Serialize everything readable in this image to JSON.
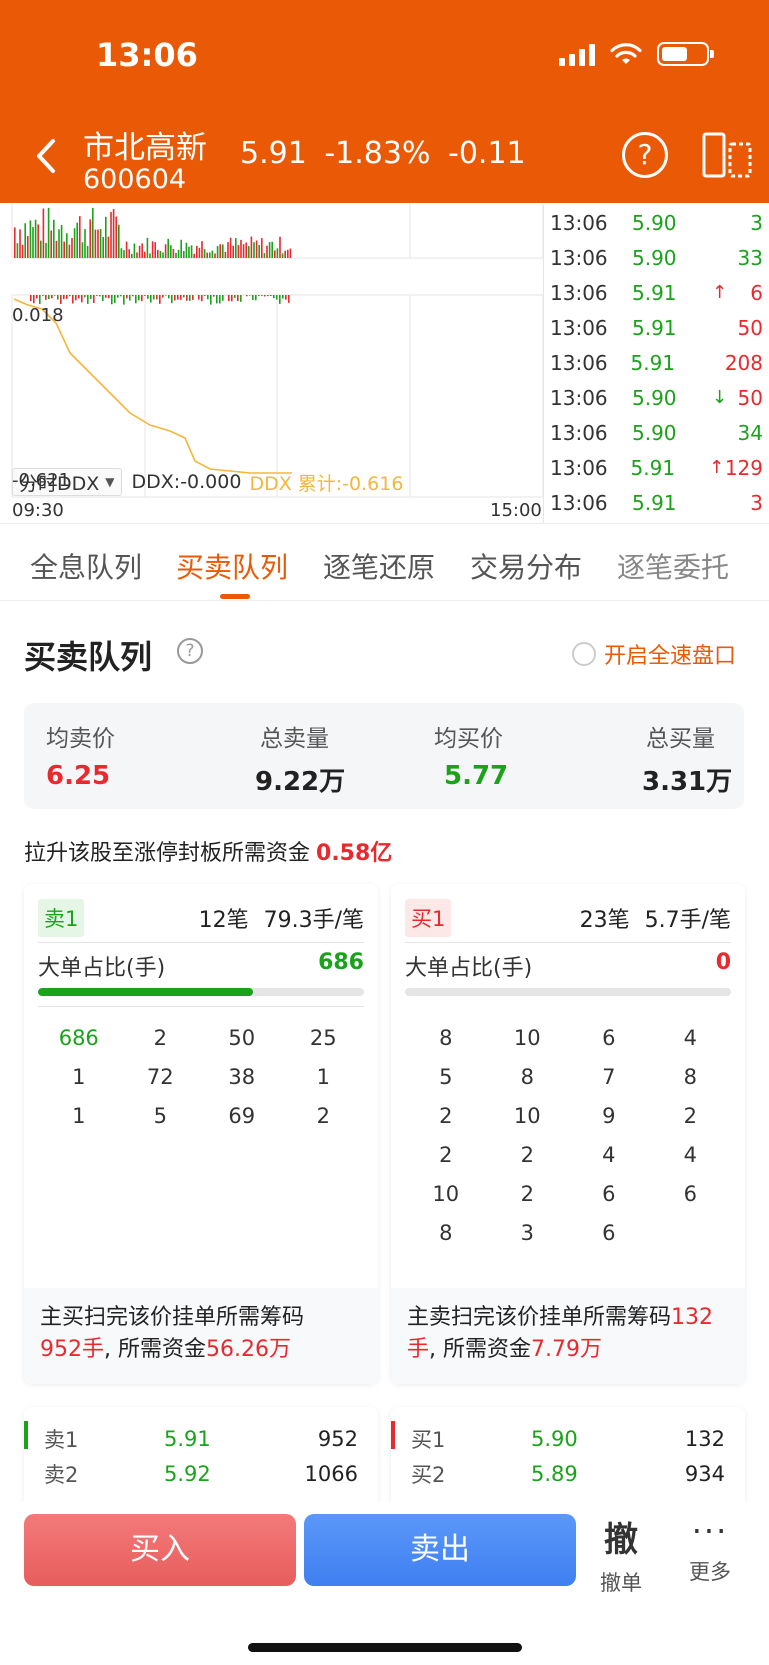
{
  "status_bar": {
    "time": "13:06"
  },
  "header": {
    "stock_name": "市北高新",
    "stock_code": "600604",
    "quote": "5.91  -1.83%  -0.11",
    "help_icon": "?"
  },
  "chart": {
    "ddx_selector": "分时DDX",
    "ddx_value": "DDX:-0.000",
    "ddx_total": "DDX 累计:-0.616",
    "y_top": "0.018",
    "y_bottom": "-0.621",
    "x_start": "09:30",
    "x_end": "15:00",
    "line_color": "#f5b63c"
  },
  "ticks": [
    {
      "time": "13:06",
      "price": "5.90",
      "arrow": "",
      "vol": "3",
      "vol_color": "green"
    },
    {
      "time": "13:06",
      "price": "5.90",
      "arrow": "",
      "vol": "33",
      "vol_color": "green"
    },
    {
      "time": "13:06",
      "price": "5.91",
      "arrow": "↑",
      "vol": "6",
      "vol_color": "red"
    },
    {
      "time": "13:06",
      "price": "5.91",
      "arrow": "",
      "vol": "50",
      "vol_color": "red"
    },
    {
      "time": "13:06",
      "price": "5.91",
      "arrow": "",
      "vol": "208",
      "vol_color": "red"
    },
    {
      "time": "13:06",
      "price": "5.90",
      "arrow": "↓",
      "vol": "50",
      "vol_color": "red"
    },
    {
      "time": "13:06",
      "price": "5.90",
      "arrow": "",
      "vol": "34",
      "vol_color": "green"
    },
    {
      "time": "13:06",
      "price": "5.91",
      "arrow": "↑",
      "vol": "129",
      "vol_color": "red"
    },
    {
      "time": "13:06",
      "price": "5.91",
      "arrow": "",
      "vol": "3",
      "vol_color": "red"
    }
  ],
  "tabs": [
    "全息队列",
    "买卖队列",
    "逐笔还原",
    "交易分布",
    "逐笔委托"
  ],
  "active_tab": "买卖队列",
  "section": {
    "title": "买卖队列",
    "help": "?",
    "fast_toggle": "开启全速盘口"
  },
  "summary": {
    "avg_sell_label": "均卖价",
    "avg_sell": "6.25",
    "total_sell_label": "总卖量",
    "total_sell": "9.22万",
    "avg_buy_label": "均买价",
    "avg_buy": "5.77",
    "total_buy_label": "总买量",
    "total_buy": "3.31万"
  },
  "raise": {
    "label": "拉升该股至涨停封板所需资金",
    "value": "0.58亿"
  },
  "sell_queue": {
    "badge": "卖1",
    "meta": "12笔  79.3手/笔",
    "big_label": "大单占比(手)",
    "big_value": "686",
    "big_ratio": 0.66,
    "rows": [
      [
        "686",
        "2",
        "50",
        "25"
      ],
      [
        "1",
        "72",
        "38",
        "1"
      ],
      [
        "1",
        "5",
        "69",
        "2"
      ]
    ],
    "foot_a": "主买扫完该价挂单所需筹码",
    "foot_b": "952手",
    "foot_c": ", 所需资金",
    "foot_d": "56.26万"
  },
  "buy_queue": {
    "badge": "买1",
    "meta": "23笔  5.7手/笔",
    "big_label": "大单占比(手)",
    "big_value": "0",
    "big_ratio": 0,
    "rows": [
      [
        "8",
        "10",
        "6",
        "4"
      ],
      [
        "5",
        "8",
        "7",
        "8"
      ],
      [
        "2",
        "10",
        "9",
        "2"
      ],
      [
        "2",
        "2",
        "4",
        "4"
      ],
      [
        "10",
        "2",
        "6",
        "6"
      ],
      [
        "8",
        "3",
        "6",
        ""
      ]
    ],
    "foot_a": "主卖扫完该价挂单所需筹码",
    "foot_b": "132手",
    "foot_c": ", 所需资金",
    "foot_d": "7.79万"
  },
  "sell_levels": [
    {
      "label": "卖1",
      "price": "5.91",
      "vol": "952"
    },
    {
      "label": "卖2",
      "price": "5.92",
      "vol": "1066"
    }
  ],
  "buy_levels": [
    {
      "label": "买1",
      "price": "5.90",
      "vol": "132"
    },
    {
      "label": "买2",
      "price": "5.89",
      "vol": "934"
    }
  ],
  "bottom": {
    "buy": "买入",
    "sell": "卖出",
    "cancel_glyph": "撤",
    "cancel": "撤单",
    "more_glyph": "···",
    "more": "更多"
  }
}
